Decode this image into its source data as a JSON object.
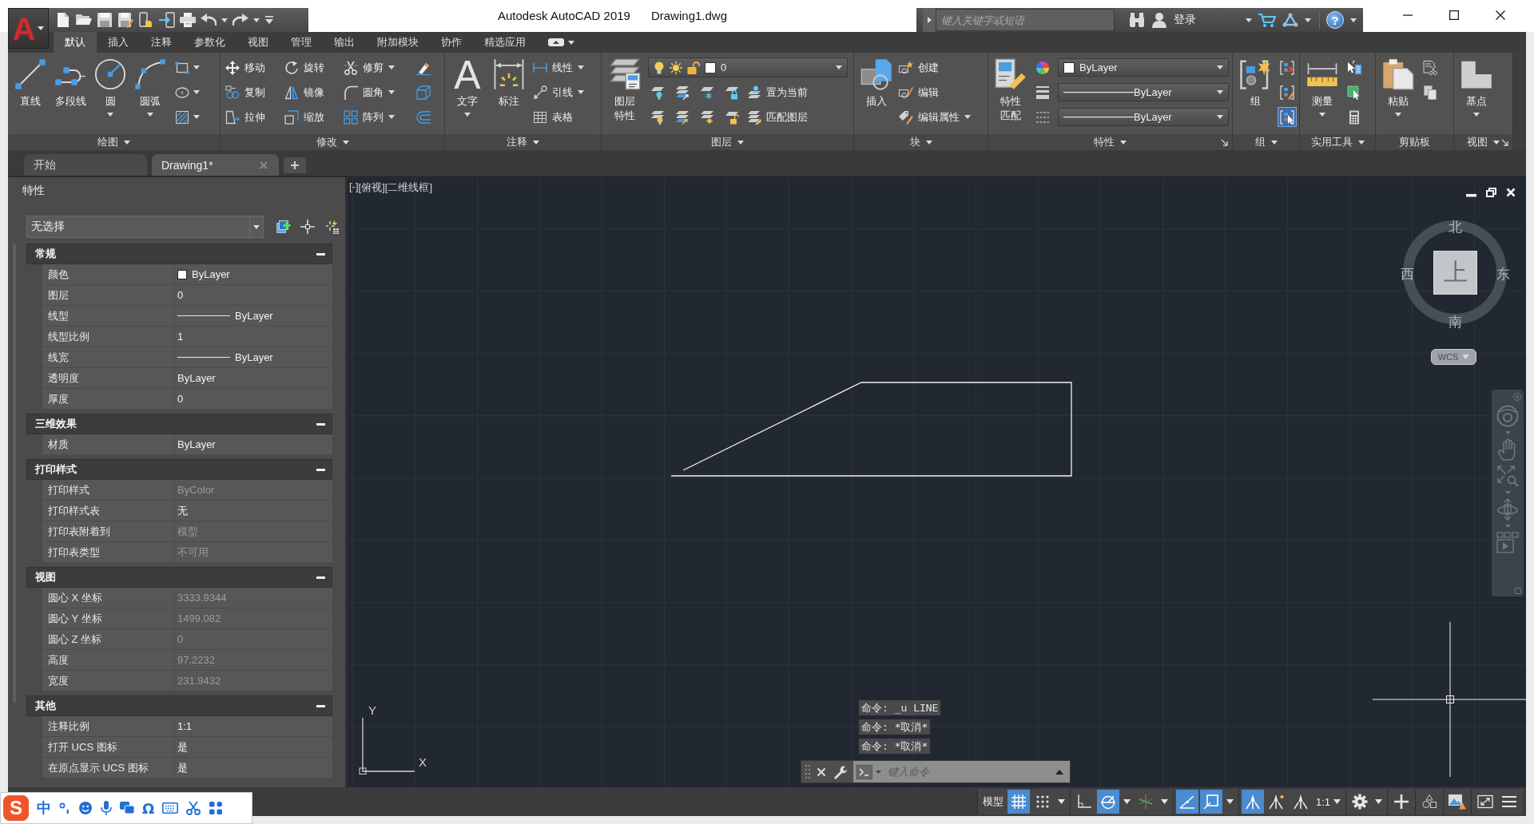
{
  "title_bar": {
    "app_logo": "A",
    "app_name": "Autodesk AutoCAD 2019",
    "document": "Drawing1.dwg",
    "search": {
      "placeholder": "键入关键字或短语"
    },
    "sign_in": "登录",
    "help": "?"
  },
  "ribbon_tabs": [
    {
      "label": "默认",
      "selected": true
    },
    {
      "label": "插入",
      "selected": false
    },
    {
      "label": "注释",
      "selected": false
    },
    {
      "label": "参数化",
      "selected": false
    },
    {
      "label": "视图",
      "selected": false
    },
    {
      "label": "管理",
      "selected": false
    },
    {
      "label": "输出",
      "selected": false
    },
    {
      "label": "附加模块",
      "selected": false
    },
    {
      "label": "协作",
      "selected": false
    },
    {
      "label": "精选应用",
      "selected": false
    }
  ],
  "ribbon_panels": [
    {
      "title": "绘图",
      "menu": true,
      "launcher": false,
      "columns": [
        [
          {
            "kind": "large",
            "label": "直线",
            "dropdown": false
          }
        ],
        [
          {
            "kind": "large",
            "label": "多段线",
            "dropdown": false
          }
        ],
        [
          {
            "kind": "large",
            "label": "圆",
            "dropdown": true
          }
        ],
        [
          {
            "kind": "large",
            "label": "圆弧",
            "dropdown": true
          }
        ],
        [
          {
            "kind": "icon",
            "dropdown": true
          },
          {
            "kind": "icon",
            "dropdown": true
          },
          {
            "kind": "icon",
            "dropdown": true
          }
        ]
      ]
    },
    {
      "title": "修改",
      "menu": true,
      "launcher": false,
      "columns": [
        [
          {
            "kind": "small",
            "label": "移动",
            "dropdown": false
          },
          {
            "kind": "small",
            "label": "复制",
            "dropdown": false
          },
          {
            "kind": "small",
            "label": "拉伸",
            "dropdown": false
          }
        ],
        [
          {
            "kind": "small",
            "label": "旋转",
            "dropdown": false
          },
          {
            "kind": "small",
            "label": "镜像",
            "dropdown": false
          },
          {
            "kind": "small",
            "label": "缩放",
            "dropdown": false
          }
        ],
        [
          {
            "kind": "small",
            "label": "修剪",
            "dropdown": true
          },
          {
            "kind": "small",
            "label": "圆角",
            "dropdown": true
          },
          {
            "kind": "small",
            "label": "阵列",
            "dropdown": true
          }
        ],
        [
          {
            "kind": "icon",
            "dropdown": false
          },
          {
            "kind": "icon",
            "dropdown": false
          },
          {
            "kind": "icon",
            "dropdown": false
          }
        ]
      ]
    },
    {
      "title": "注释",
      "menu": true,
      "launcher": false,
      "columns": [
        [
          {
            "kind": "large",
            "glyph": "A",
            "label": "文字",
            "dropdown": true
          }
        ],
        [
          {
            "kind": "large",
            "label": "标注",
            "dropdown": false
          }
        ],
        [
          {
            "kind": "small",
            "label": "线性",
            "dropdown": true
          },
          {
            "kind": "small",
            "label": "引线",
            "dropdown": true
          },
          {
            "kind": "small",
            "label": "表格",
            "dropdown": false
          }
        ]
      ]
    },
    {
      "title": "图层",
      "menu": true,
      "launcher": false,
      "columns": [
        [
          {
            "kind": "large",
            "label": "图层特性",
            "dropdown": false
          }
        ],
        [
          {
            "kind": "layer_combo",
            "value": "0"
          },
          {
            "kind": "row",
            "items": [
              {
                "kind": "icon",
                "dropdown": false
              },
              {
                "kind": "icon",
                "dropdown": false
              },
              {
                "kind": "icon",
                "dropdown": false
              },
              {
                "kind": "icon",
                "dropdown": false
              },
              {
                "kind": "small",
                "label": "置为当前",
                "dropdown": false
              }
            ]
          },
          {
            "kind": "row",
            "items": [
              {
                "kind": "icon",
                "dropdown": false
              },
              {
                "kind": "icon",
                "dropdown": false
              },
              {
                "kind": "icon",
                "dropdown": false
              },
              {
                "kind": "icon",
                "dropdown": false
              },
              {
                "kind": "small",
                "label": "匹配图层",
                "dropdown": false
              }
            ]
          }
        ]
      ]
    },
    {
      "title": "块",
      "menu": true,
      "launcher": false,
      "columns": [
        [
          {
            "kind": "large",
            "label": "插入",
            "dropdown": false
          }
        ],
        [
          {
            "kind": "small",
            "label": "创建",
            "dropdown": false
          },
          {
            "kind": "small",
            "label": "编辑",
            "dropdown": false
          },
          {
            "kind": "small",
            "label": "编辑属性",
            "dropdown": true
          }
        ]
      ]
    },
    {
      "title": "特性",
      "menu": true,
      "launcher": true,
      "columns": [
        [
          {
            "kind": "large",
            "label": "特性匹配",
            "dropdown": false
          }
        ],
        [
          {
            "kind": "row",
            "items": [
              {
                "kind": "icon",
                "dropdown": false
              },
              {
                "kind": "color_combo",
                "value": "ByLayer"
              }
            ]
          },
          {
            "kind": "row",
            "items": [
              {
                "kind": "icon",
                "dropdown": false
              },
              {
                "kind": "line_combo",
                "value": "ByLayer"
              }
            ]
          },
          {
            "kind": "row",
            "items": [
              {
                "kind": "icon",
                "dropdown": false
              },
              {
                "kind": "line_combo",
                "value": "ByLayer"
              }
            ]
          }
        ]
      ]
    },
    {
      "title": "组",
      "menu": true,
      "launcher": false,
      "columns": [
        [
          {
            "kind": "large",
            "label": "组",
            "dropdown": false
          }
        ],
        [
          {
            "kind": "icon",
            "dropdown": false,
            "on": false
          },
          {
            "kind": "icon",
            "dropdown": false,
            "on": false
          },
          {
            "kind": "icon",
            "dropdown": false,
            "on": true
          }
        ]
      ]
    },
    {
      "title": "实用工具",
      "menu": true,
      "launcher": false,
      "columns": [
        [
          {
            "kind": "large",
            "label": "测量",
            "dropdown": true
          }
        ],
        [
          {
            "kind": "icon",
            "dropdown": false
          },
          {
            "kind": "icon",
            "dropdown": false
          },
          {
            "kind": "icon",
            "dropdown": false
          }
        ]
      ]
    },
    {
      "title": "剪贴板",
      "menu": false,
      "launcher": false,
      "columns": [
        [
          {
            "kind": "large",
            "label": "粘贴",
            "dropdown": true
          }
        ],
        [
          {
            "kind": "icon",
            "dropdown": false
          },
          {
            "kind": "icon",
            "dropdown": false
          }
        ]
      ]
    },
    {
      "title": "视图",
      "menu": true,
      "launcher": true,
      "columns": [
        [
          {
            "kind": "large",
            "label": "基点",
            "dropdown": true
          }
        ]
      ]
    }
  ],
  "document_tabs": [
    {
      "label": "开始",
      "selected": false,
      "closable": false
    },
    {
      "label": "Drawing1*",
      "selected": true,
      "closable": true
    }
  ],
  "properties": {
    "title": "特性",
    "selection": "无选择",
    "sections": [
      {
        "title": "常规",
        "expanded": true,
        "rows": [
          {
            "label": "颜色",
            "kind": "color",
            "value": "ByLayer",
            "disabled": false
          },
          {
            "label": "图层",
            "kind": "text",
            "value": "0",
            "disabled": false
          },
          {
            "label": "线型",
            "kind": "line",
            "value": "ByLayer",
            "disabled": false
          },
          {
            "label": "线型比例",
            "kind": "text",
            "value": "1",
            "disabled": false
          },
          {
            "label": "线宽",
            "kind": "line",
            "value": "ByLayer",
            "disabled": false
          },
          {
            "label": "透明度",
            "kind": "text",
            "value": "ByLayer",
            "disabled": false
          },
          {
            "label": "厚度",
            "kind": "text",
            "value": "0",
            "disabled": false
          }
        ]
      },
      {
        "title": "三维效果",
        "expanded": true,
        "rows": [
          {
            "label": "材质",
            "kind": "text",
            "value": "ByLayer",
            "disabled": false
          }
        ]
      },
      {
        "title": "打印样式",
        "expanded": true,
        "rows": [
          {
            "label": "打印样式",
            "kind": "text",
            "value": "ByColor",
            "disabled": true
          },
          {
            "label": "打印样式表",
            "kind": "text",
            "value": "无",
            "disabled": false
          },
          {
            "label": "打印表附着到",
            "kind": "text",
            "value": "模型",
            "disabled": true
          },
          {
            "label": "打印表类型",
            "kind": "text",
            "value": "不可用",
            "disabled": true
          }
        ]
      },
      {
        "title": "视图",
        "expanded": true,
        "rows": [
          {
            "label": "圆心 X 坐标",
            "kind": "text",
            "value": "3333.9344",
            "disabled": true
          },
          {
            "label": "圆心 Y 坐标",
            "kind": "text",
            "value": "1499.082",
            "disabled": true
          },
          {
            "label": "圆心 Z 坐标",
            "kind": "text",
            "value": "0",
            "disabled": true
          },
          {
            "label": "高度",
            "kind": "text",
            "value": "97.2232",
            "disabled": true
          },
          {
            "label": "宽度",
            "kind": "text",
            "value": "231.9432",
            "disabled": true
          }
        ]
      },
      {
        "title": "其他",
        "expanded": true,
        "rows": [
          {
            "label": "注释比例",
            "kind": "text",
            "value": "1:1",
            "disabled": false
          },
          {
            "label": "打开 UCS 图标",
            "kind": "text",
            "value": "是",
            "disabled": false
          },
          {
            "label": "在原点显示 UCS 图标",
            "kind": "text",
            "value": "是",
            "disabled": false
          }
        ]
      }
    ]
  },
  "viewport": {
    "view_controls": [
      "[-]",
      "[俯视]",
      "[二维线框]"
    ],
    "viewcube": {
      "north": "北",
      "west": "西",
      "east": "东",
      "south": "南",
      "face": "上",
      "ucs_menu": "WCS"
    },
    "ucs_icon": {
      "x_label": "X",
      "y_label": "Y"
    },
    "command_history": [
      "命令: _u LINE",
      "命令: *取消*",
      "命令: *取消*"
    ],
    "command_line": {
      "placeholder": "键入命令"
    }
  },
  "status_bar": {
    "groups": [
      [
        {
          "kind": "text",
          "label": "模型"
        },
        {
          "kind": "toggle",
          "on": true
        },
        {
          "kind": "toggle",
          "on": false
        },
        {
          "kind": "menu"
        }
      ],
      [
        {
          "kind": "toggle",
          "on": false
        },
        {
          "kind": "toggle",
          "on": true
        },
        {
          "kind": "menu"
        },
        {
          "kind": "toggle",
          "on": false
        },
        {
          "kind": "menu"
        }
      ],
      [
        {
          "kind": "toggle",
          "on": true
        },
        {
          "kind": "toggle",
          "on": true
        },
        {
          "kind": "menu"
        }
      ],
      [
        {
          "kind": "toggle",
          "on": true
        },
        {
          "kind": "toggle",
          "on": false
        },
        {
          "kind": "toggle",
          "on": false
        },
        {
          "kind": "scale",
          "label": "1:1"
        }
      ],
      [
        {
          "kind": "toggle",
          "on": false
        },
        {
          "kind": "menu"
        }
      ],
      [
        {
          "kind": "toggle",
          "on": false
        }
      ],
      [
        {
          "kind": "toggle",
          "on": false
        }
      ],
      [
        {
          "kind": "toggle",
          "on": false
        }
      ],
      [
        {
          "kind": "toggle",
          "on": false
        },
        {
          "kind": "toggle",
          "on": false
        }
      ]
    ]
  },
  "input_method_bar": {
    "logo": "S",
    "mode": "中",
    "symbols": "Ω"
  }
}
